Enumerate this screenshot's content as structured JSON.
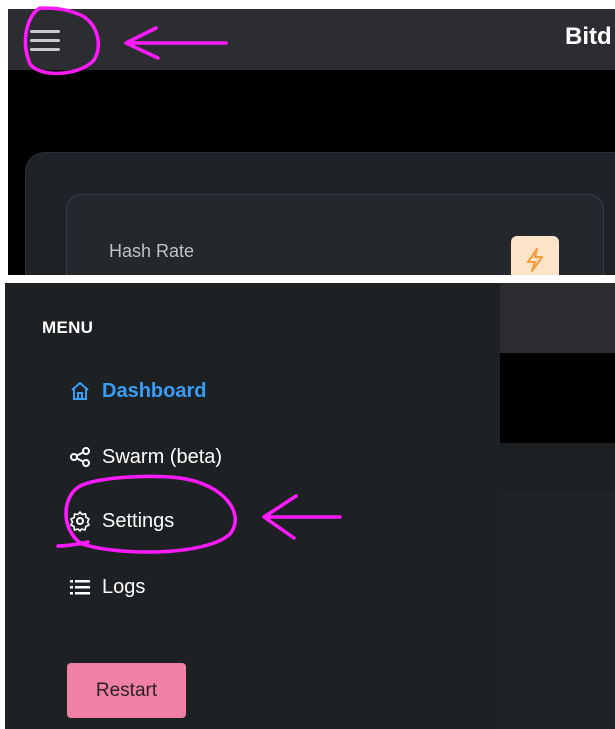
{
  "header": {
    "app_title": "Bitd"
  },
  "dashboard_card": {
    "hash_label": "Hash Rate",
    "badge_icon": "lightning-icon"
  },
  "sidebar": {
    "menu_title": "MENU",
    "items": [
      {
        "label": "Dashboard",
        "icon": "home-icon",
        "active": true
      },
      {
        "label": "Swarm (beta)",
        "icon": "share-icon",
        "active": false
      },
      {
        "label": "Settings",
        "icon": "gear-icon",
        "active": false
      },
      {
        "label": "Logs",
        "icon": "list-icon",
        "active": false
      }
    ],
    "restart_label": "Restart"
  },
  "colors": {
    "accent_active": "#3a9df5",
    "restart_button": "#f081a4",
    "badge_bg": "#fde3c7",
    "badge_icon": "#f59a3a",
    "annotation": "#ff1aff",
    "sidebar_bg": "#1e2124",
    "topbar_bg": "#2b2d30"
  }
}
